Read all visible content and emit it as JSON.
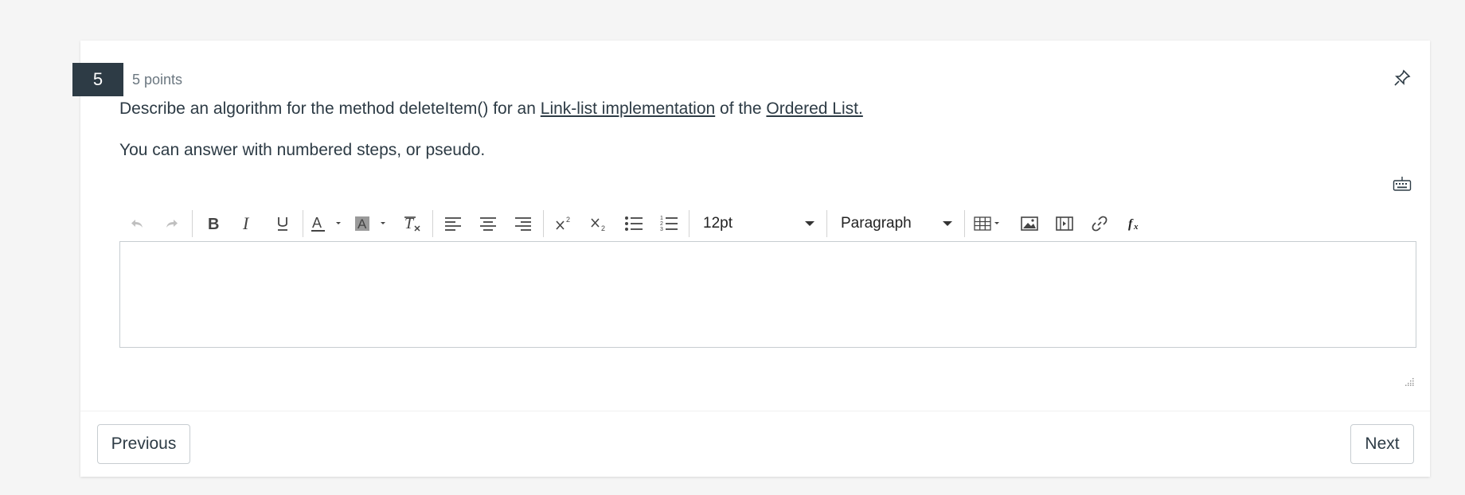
{
  "question": {
    "number": "5",
    "points": "5 points",
    "text_before": "Describe an algorithm for the method deleteItem() for an ",
    "link1": "Link-list implementation",
    "text_middle": " of the ",
    "link2": "Ordered List.",
    "line2": "You can answer with numbered steps, or pseudo."
  },
  "toolbar": {
    "font_size": "12pt",
    "block_format": "Paragraph",
    "icons": [
      "undo-icon",
      "redo-icon",
      "bold-icon",
      "italic-icon",
      "underline-icon",
      "text-color-icon",
      "background-color-icon",
      "clear-formatting-icon",
      "align-left-icon",
      "align-center-icon",
      "align-right-icon",
      "superscript-icon",
      "subscript-icon",
      "bullet-list-icon",
      "numbered-list-icon",
      "table-icon",
      "image-icon",
      "media-icon",
      "link-icon",
      "equation-icon"
    ]
  },
  "editor": {
    "value": ""
  },
  "nav": {
    "previous_label": "Previous",
    "next_label": "Next"
  },
  "colors": {
    "badge": "#2d3b45",
    "text": "#2d3b45",
    "muted": "#6b7780",
    "border": "#c7cdd1"
  }
}
